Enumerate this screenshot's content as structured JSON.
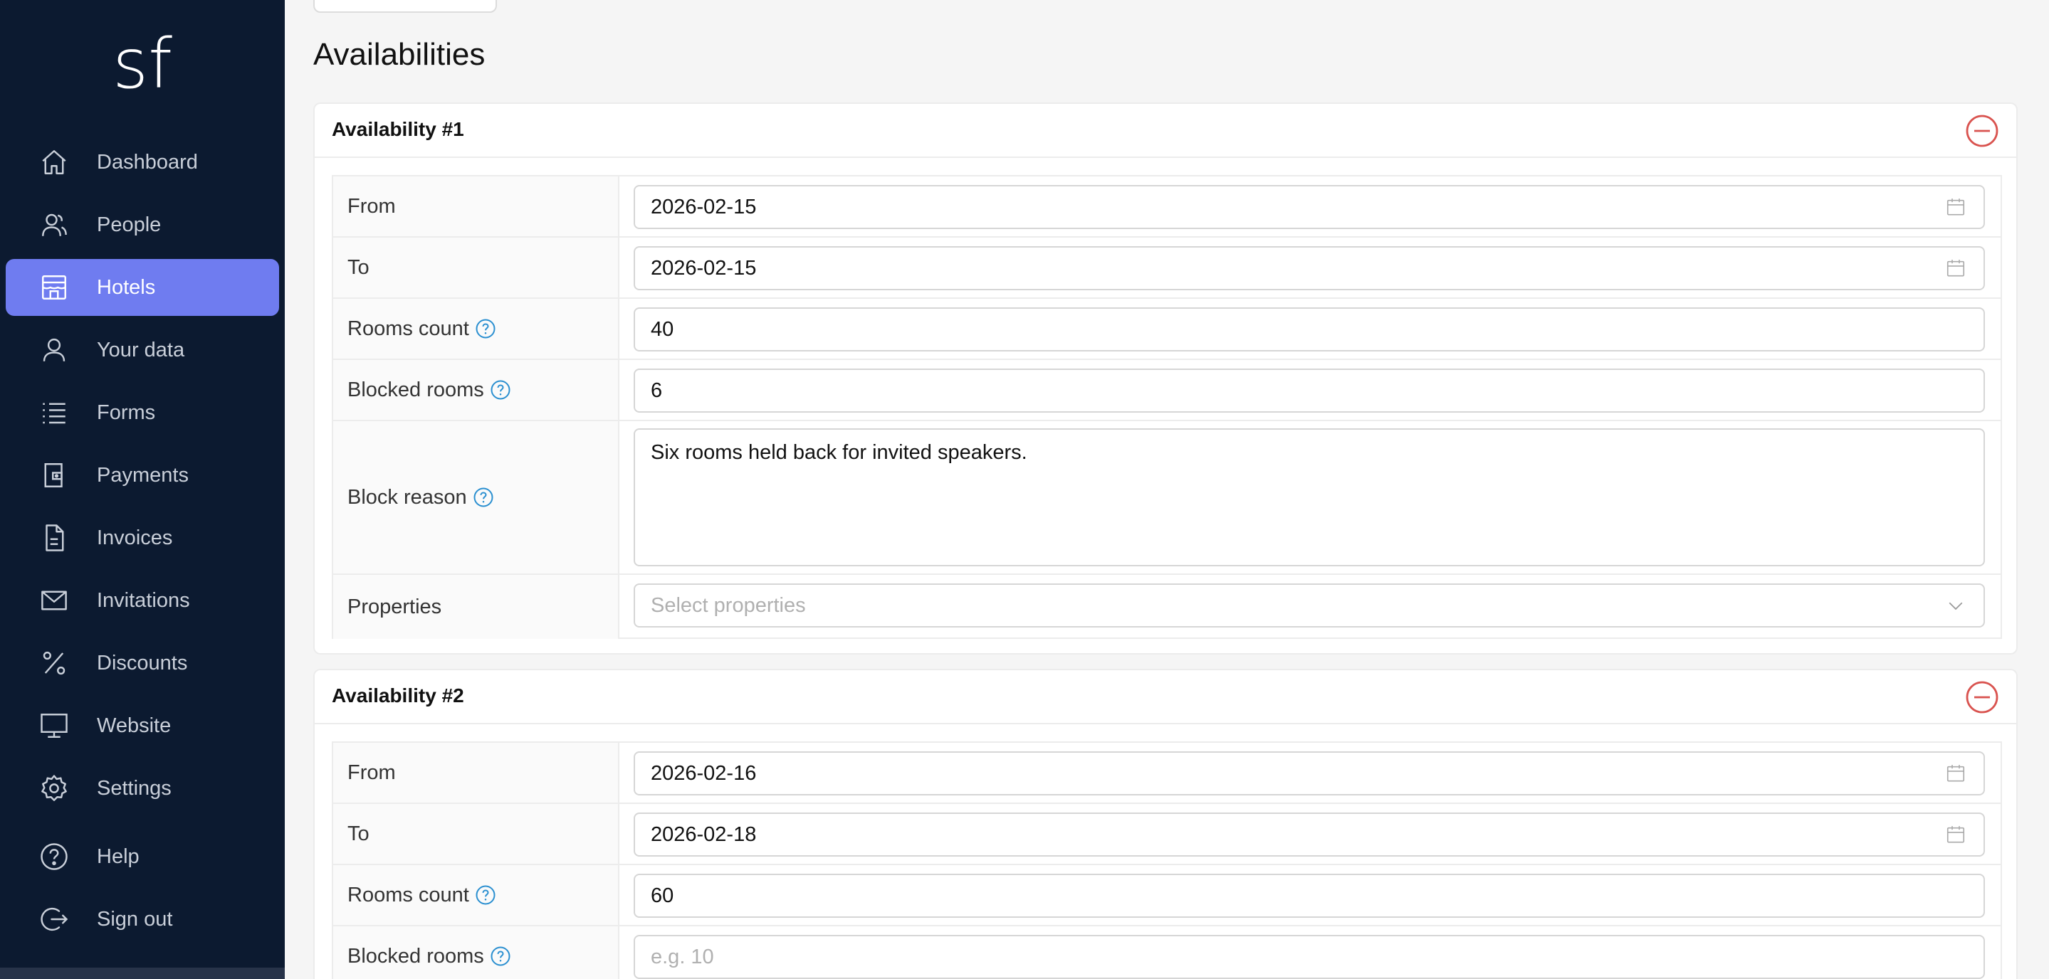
{
  "sidebar": {
    "logo_text": "sf",
    "items": [
      {
        "label": "Dashboard",
        "icon": "home-icon",
        "active": false
      },
      {
        "label": "People",
        "icon": "people-icon",
        "active": false
      },
      {
        "label": "Hotels",
        "icon": "hotel-icon",
        "active": true
      },
      {
        "label": "Your data",
        "icon": "user-icon",
        "active": false
      },
      {
        "label": "Forms",
        "icon": "list-icon",
        "active": false
      },
      {
        "label": "Payments",
        "icon": "wallet-icon",
        "active": false
      },
      {
        "label": "Invoices",
        "icon": "document-icon",
        "active": false
      },
      {
        "label": "Invitations",
        "icon": "envelope-icon",
        "active": false
      },
      {
        "label": "Discounts",
        "icon": "percent-icon",
        "active": false
      },
      {
        "label": "Website",
        "icon": "monitor-icon",
        "active": false
      },
      {
        "label": "Settings",
        "icon": "gear-icon",
        "active": false
      },
      {
        "label": "Help",
        "icon": "help-circle-icon",
        "active": false
      },
      {
        "label": "Sign out",
        "icon": "sign-out-icon",
        "active": false
      }
    ]
  },
  "main": {
    "section_title": "Availabilities",
    "availabilities": [
      {
        "title": "Availability #1",
        "labels": {
          "from": "From",
          "to": "To",
          "rooms_count": "Rooms count",
          "blocked_rooms": "Blocked rooms",
          "block_reason": "Block reason",
          "properties": "Properties"
        },
        "from": "2026-02-15",
        "to": "2026-02-15",
        "rooms_count": "40",
        "blocked_rooms": "6",
        "block_reason": "Six rooms held back for invited speakers.",
        "properties_placeholder": "Select properties"
      },
      {
        "title": "Availability #2",
        "labels": {
          "from": "From",
          "to": "To",
          "rooms_count": "Rooms count",
          "blocked_rooms": "Blocked rooms"
        },
        "from": "2026-02-16",
        "to": "2026-02-18",
        "rooms_count": "60",
        "blocked_rooms_placeholder": "e.g. 10"
      }
    ]
  },
  "colors": {
    "sidebar_bg": "#0c1a30",
    "active_nav": "#6f7cf0",
    "remove_red": "#d9534f",
    "help_blue": "#2a8fd0"
  }
}
